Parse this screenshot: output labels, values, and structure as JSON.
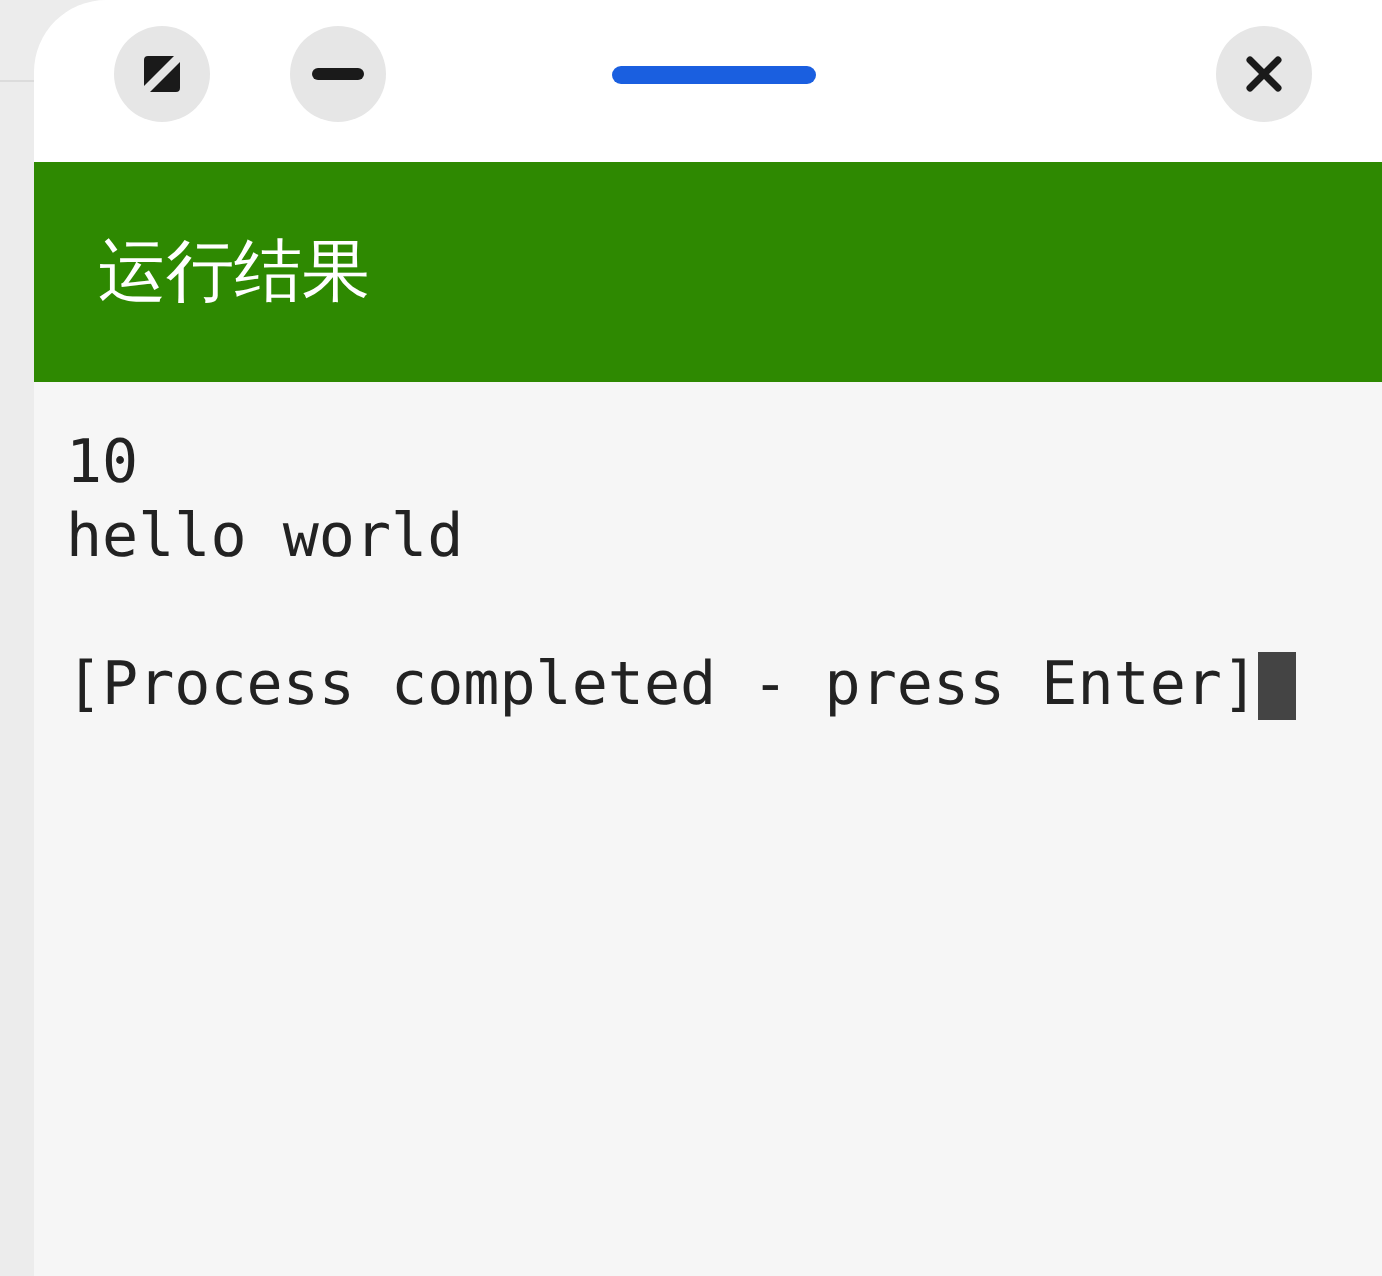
{
  "window": {
    "controls": [
      {
        "kind": "resize"
      },
      {
        "kind": "minimize"
      },
      {
        "kind": "handle"
      },
      {
        "kind": "close"
      }
    ]
  },
  "header": {
    "title": "运行结果"
  },
  "terminal": {
    "output_lines": [
      "10",
      "hello world"
    ],
    "prompt": "[Process completed - press Enter]",
    "cursor_visible": true
  }
}
